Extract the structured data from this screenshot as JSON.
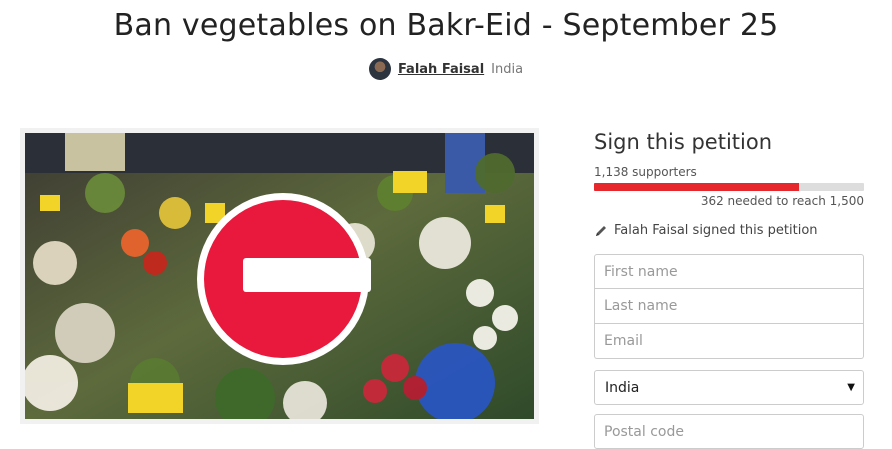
{
  "petition": {
    "title": "Ban vegetables on Bakr-Eid - September 25",
    "author_name": "Falah Faisal",
    "author_location": "India"
  },
  "image": {
    "description_icon": "no-entry-sign"
  },
  "sign": {
    "heading": "Sign this petition",
    "supporters_text": "1,138 supporters",
    "supporters": 1138,
    "goal": 1500,
    "progress_fraction": 0.7587,
    "needed_text": "362 needed to reach 1,500",
    "signed_text": "Falah Faisal signed this petition"
  },
  "form": {
    "first_name_placeholder": "First name",
    "last_name_placeholder": "Last name",
    "email_placeholder": "Email",
    "country_value": "India",
    "postal_placeholder": "Postal code"
  },
  "colors": {
    "accent": "#e6282d",
    "progress_track": "#dddddd"
  }
}
